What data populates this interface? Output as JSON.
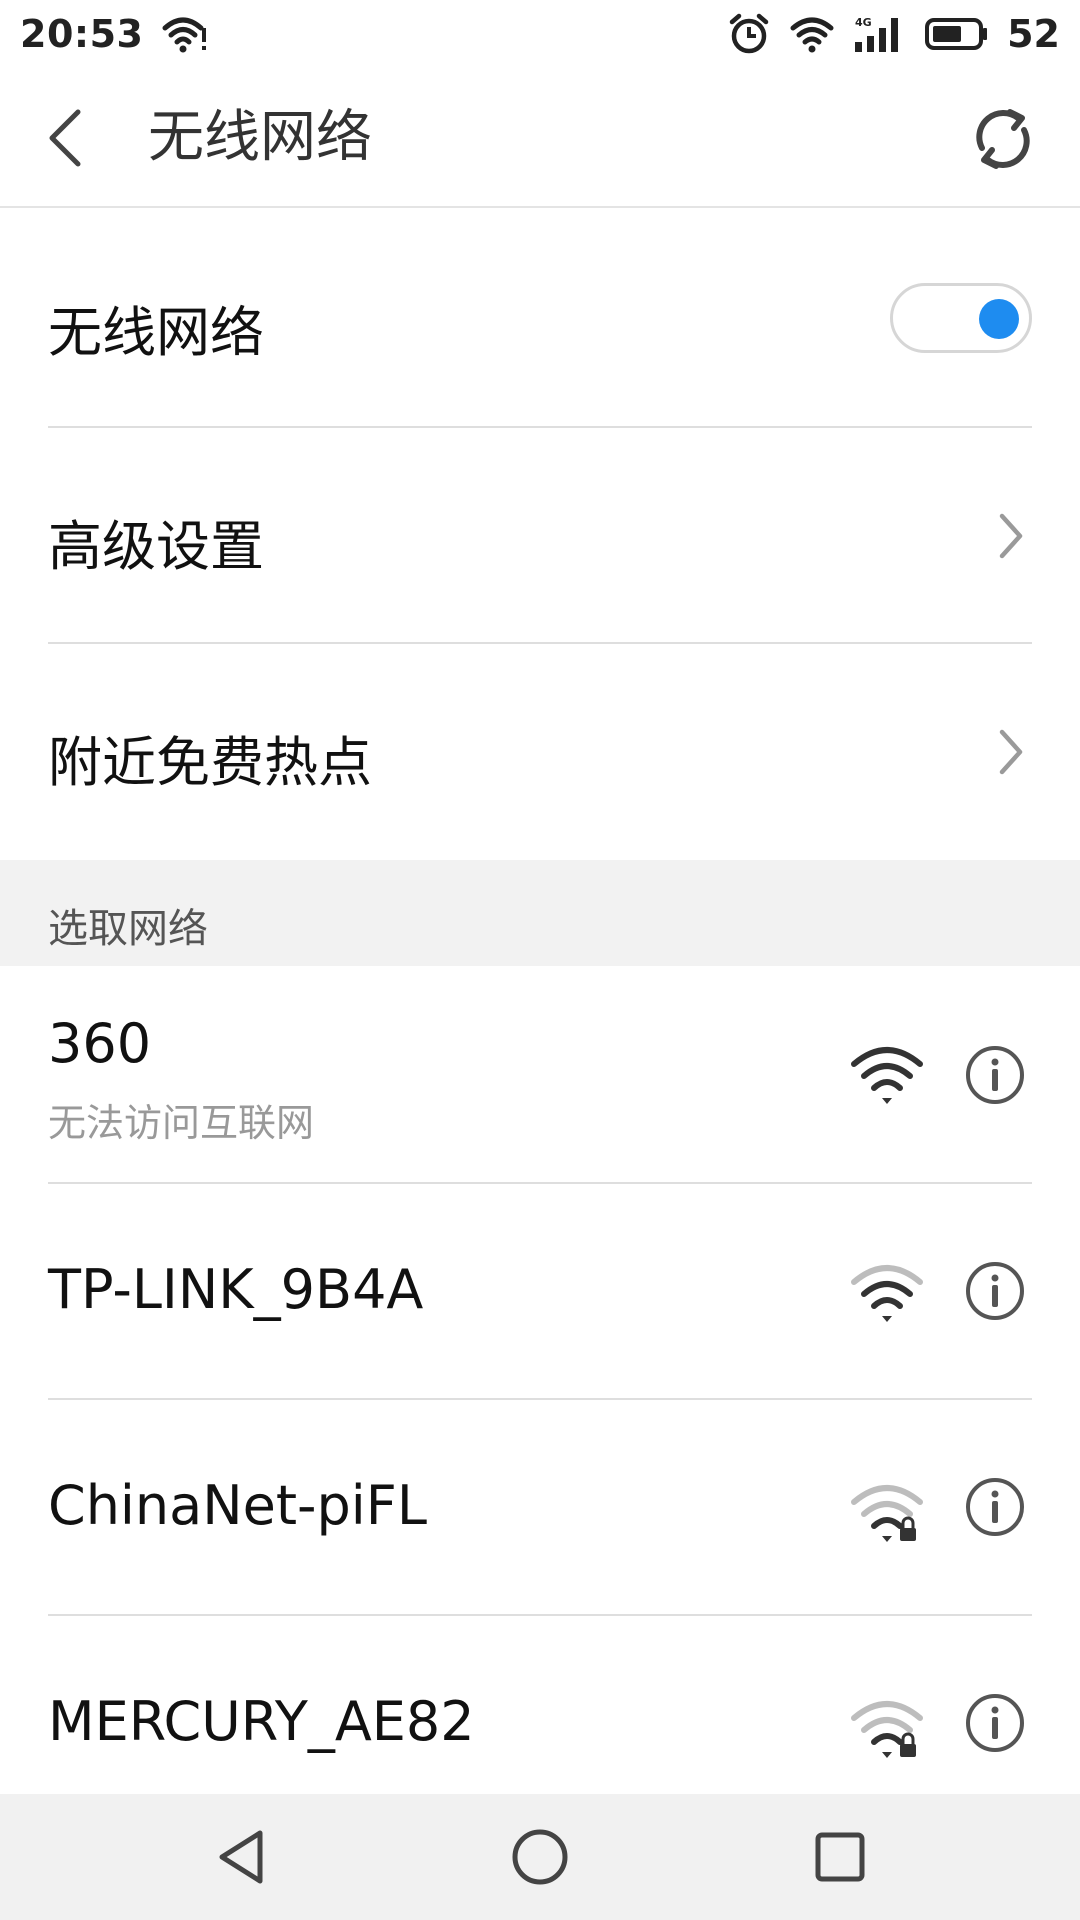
{
  "status_bar": {
    "time": "20:53",
    "battery_level": "52",
    "network_type": "4G"
  },
  "app_bar": {
    "title": "无线网络"
  },
  "settings": {
    "wifi_toggle": {
      "label": "无线网络",
      "enabled": true
    },
    "advanced": {
      "label": "高级设置"
    },
    "hotspots": {
      "label": "附近免费热点"
    }
  },
  "section": {
    "title": "选取网络"
  },
  "networks": [
    {
      "name": "360",
      "status": "无法访问互联网",
      "signal": "strong",
      "secured": false
    },
    {
      "name": "TP-LINK_9B4A",
      "status": "",
      "signal": "medium",
      "secured": false
    },
    {
      "name": "ChinaNet-piFL",
      "status": "",
      "signal": "weak",
      "secured": true
    },
    {
      "name": "MERCURY_AE82",
      "status": "",
      "signal": "weak",
      "secured": true
    }
  ],
  "colors": {
    "accent": "#1e8cf0",
    "divider": "#dedede",
    "section_bg": "#f2f2f2",
    "nav_bg": "#f1f1f1"
  }
}
